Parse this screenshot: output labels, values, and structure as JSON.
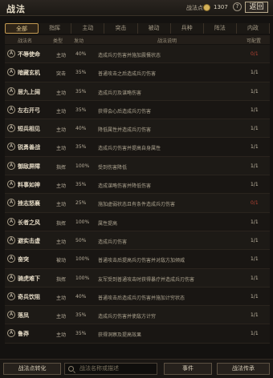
{
  "header": {
    "title": "战法",
    "points_label": "战法点",
    "points_value": "1307",
    "help": "?",
    "back": "返回"
  },
  "tabs": [
    "全部",
    "指挥",
    "主动",
    "突击",
    "被动",
    "兵种",
    "阵法",
    "内政"
  ],
  "columns": {
    "name": "战法名",
    "type": "类型",
    "rate": "发动",
    "desc": "战法说明",
    "cfg": "可配置"
  },
  "rows": [
    {
      "badge": "A",
      "name": "不辱使命",
      "type": "主动",
      "rate": "40%",
      "desc": "造成兵刃伤害并施加震慑状态",
      "cfg": "0/1"
    },
    {
      "badge": "A",
      "name": "暗藏玄机",
      "type": "突击",
      "rate": "35%",
      "desc": "普通攻击之后造成兵刃伤害",
      "cfg": "1/1"
    },
    {
      "badge": "A",
      "name": "居九上阔",
      "type": "主动",
      "rate": "35%",
      "desc": "造成兵刃及谋略伤害",
      "cfg": "1/1"
    },
    {
      "badge": "A",
      "name": "左右开弓",
      "type": "主动",
      "rate": "35%",
      "desc": "获得会心后造成兵刃伤害",
      "cfg": "1/1"
    },
    {
      "badge": "A",
      "name": "短兵相见",
      "type": "主动",
      "rate": "40%",
      "desc": "降低属性并造成兵刃伤害",
      "cfg": "1/1"
    },
    {
      "badge": "A",
      "name": "锐勇善战",
      "type": "主动",
      "rate": "35%",
      "desc": "造成兵刃伤害并提高自身属性",
      "cfg": "1/1"
    },
    {
      "badge": "A",
      "name": "御敌屏障",
      "type": "指挥",
      "rate": "100%",
      "desc": "受到伤害降低",
      "cfg": "1/1"
    },
    {
      "badge": "A",
      "name": "料事如神",
      "type": "主动",
      "rate": "35%",
      "desc": "造成谋略伤害并降低伤害",
      "cfg": "1/1"
    },
    {
      "badge": "A",
      "name": "挫志怒襄",
      "type": "主动",
      "rate": "25%",
      "desc": "施加虚弱状态且有条件造成兵刃伤害",
      "cfg": "0/1"
    },
    {
      "badge": "A",
      "name": "长者之风",
      "type": "指挥",
      "rate": "100%",
      "desc": "属性提高",
      "cfg": "1/1"
    },
    {
      "badge": "A",
      "name": "避实击虚",
      "type": "主动",
      "rate": "50%",
      "desc": "造成兵刃伤害",
      "cfg": "1/1"
    },
    {
      "badge": "A",
      "name": "奋突",
      "type": "被动",
      "rate": "100%",
      "desc": "普通攻击后提高兵刃伤害并对敌方加倾威",
      "cfg": "1/1"
    },
    {
      "badge": "A",
      "name": "骑虎难下",
      "type": "指挥",
      "rate": "100%",
      "desc": "友军受到普通攻击时获得暴疗并造成兵刃伤害",
      "cfg": "1/1"
    },
    {
      "badge": "A",
      "name": "奇兵饮阻",
      "type": "主动",
      "rate": "40%",
      "desc": "普通攻击后造成兵刃伤害并施加计穷状态",
      "cfg": "1/1"
    },
    {
      "badge": "A",
      "name": "落凤",
      "type": "主动",
      "rate": "35%",
      "desc": "造成兵刃伤害并使敌方计穷",
      "cfg": "1/1"
    },
    {
      "badge": "A",
      "name": "鲁莽",
      "type": "主动",
      "rate": "35%",
      "desc": "获得洞察及提高效果",
      "cfg": "1/1"
    }
  ],
  "footer": {
    "convert": "战法点转化",
    "search_placeholder": "战法名称或描述",
    "events": "事件",
    "inherit": "战法传承"
  }
}
